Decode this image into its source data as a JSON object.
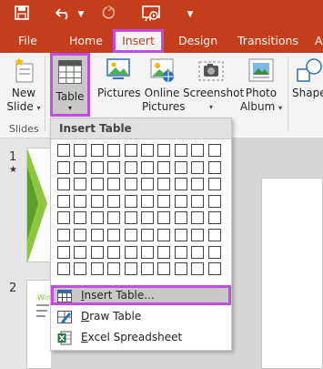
{
  "tabs": [
    {
      "label": "File"
    },
    {
      "label": "Home"
    },
    {
      "label": "Insert",
      "active": true
    },
    {
      "label": "Design"
    },
    {
      "label": "Transitions"
    },
    {
      "label": "A"
    }
  ],
  "ribbon": {
    "new_slide": {
      "line1": "New",
      "line2": "Slide"
    },
    "table": {
      "label": "Table"
    },
    "pictures": {
      "label": "Pictures"
    },
    "online_pictures": {
      "line1": "Online",
      "line2": "Pictures"
    },
    "screenshot": {
      "label": "Screenshot"
    },
    "photo_album": {
      "line1": "Photo",
      "line2": "Album"
    },
    "shapes": {
      "label": "Shape"
    },
    "group_slides": "Slides"
  },
  "slide_panel": {
    "slide1": "1",
    "slide1_mark": "★",
    "slide2": "2",
    "slide2_title": "Win"
  },
  "insert_table_menu": {
    "header": "Insert Table",
    "grid": {
      "columns": 10,
      "rows": 8
    },
    "items": [
      {
        "label": "Insert Table...",
        "access_key": "I",
        "rest": "nsert Table..."
      },
      {
        "label": "Draw Table",
        "access_key": "D",
        "rest": "raw Table"
      },
      {
        "label": "Excel Spreadsheet",
        "access_key": "E",
        "rest": "xcel Spreadsheet"
      }
    ]
  },
  "colors": {
    "accent": "#c43e1c",
    "highlight_outline": "#c24de6"
  }
}
